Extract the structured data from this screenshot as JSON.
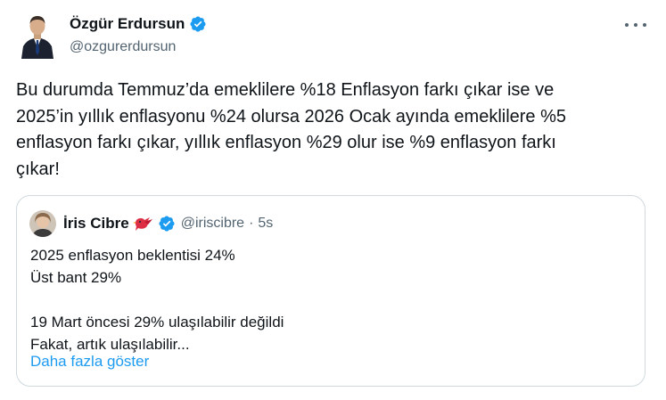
{
  "tweet": {
    "author_name": "Özgür Erdursun",
    "author_handle": "@ozgurerdursun",
    "text": "Bu durumda Temmuz’da emeklilere %18 Enflasyon farkı çıkar ise ve\n2025’in yıllık enflasyonu %24 olursa 2026 Ocak ayında emeklilere %5\nenflasyon farkı çıkar, yıllık enflasyon %29 olur ise %9 enflasyon farkı\nçıkar!",
    "icons": [
      "avatar",
      "verified-badge-icon",
      "more-icon"
    ]
  },
  "quote": {
    "author_name": "İris Cibre",
    "author_handle": "@iriscibre",
    "separator": "·",
    "time": "5s",
    "text": "2025 enflasyon beklentisi 24%\nÜst bant 29%\n\n19 Mart öncesi 29% ulaşılabilir değildi\nFakat, artık ulaşılabilir...",
    "show_more": "Daha fazla göster",
    "icons": [
      "avatar",
      "bird-emoji-icon",
      "verified-badge-icon"
    ]
  },
  "colors": {
    "text": "#0f1419",
    "secondary": "#536471",
    "link": "#1d9bf0",
    "verified": "#1d9bf0",
    "border": "#cfd9de"
  }
}
